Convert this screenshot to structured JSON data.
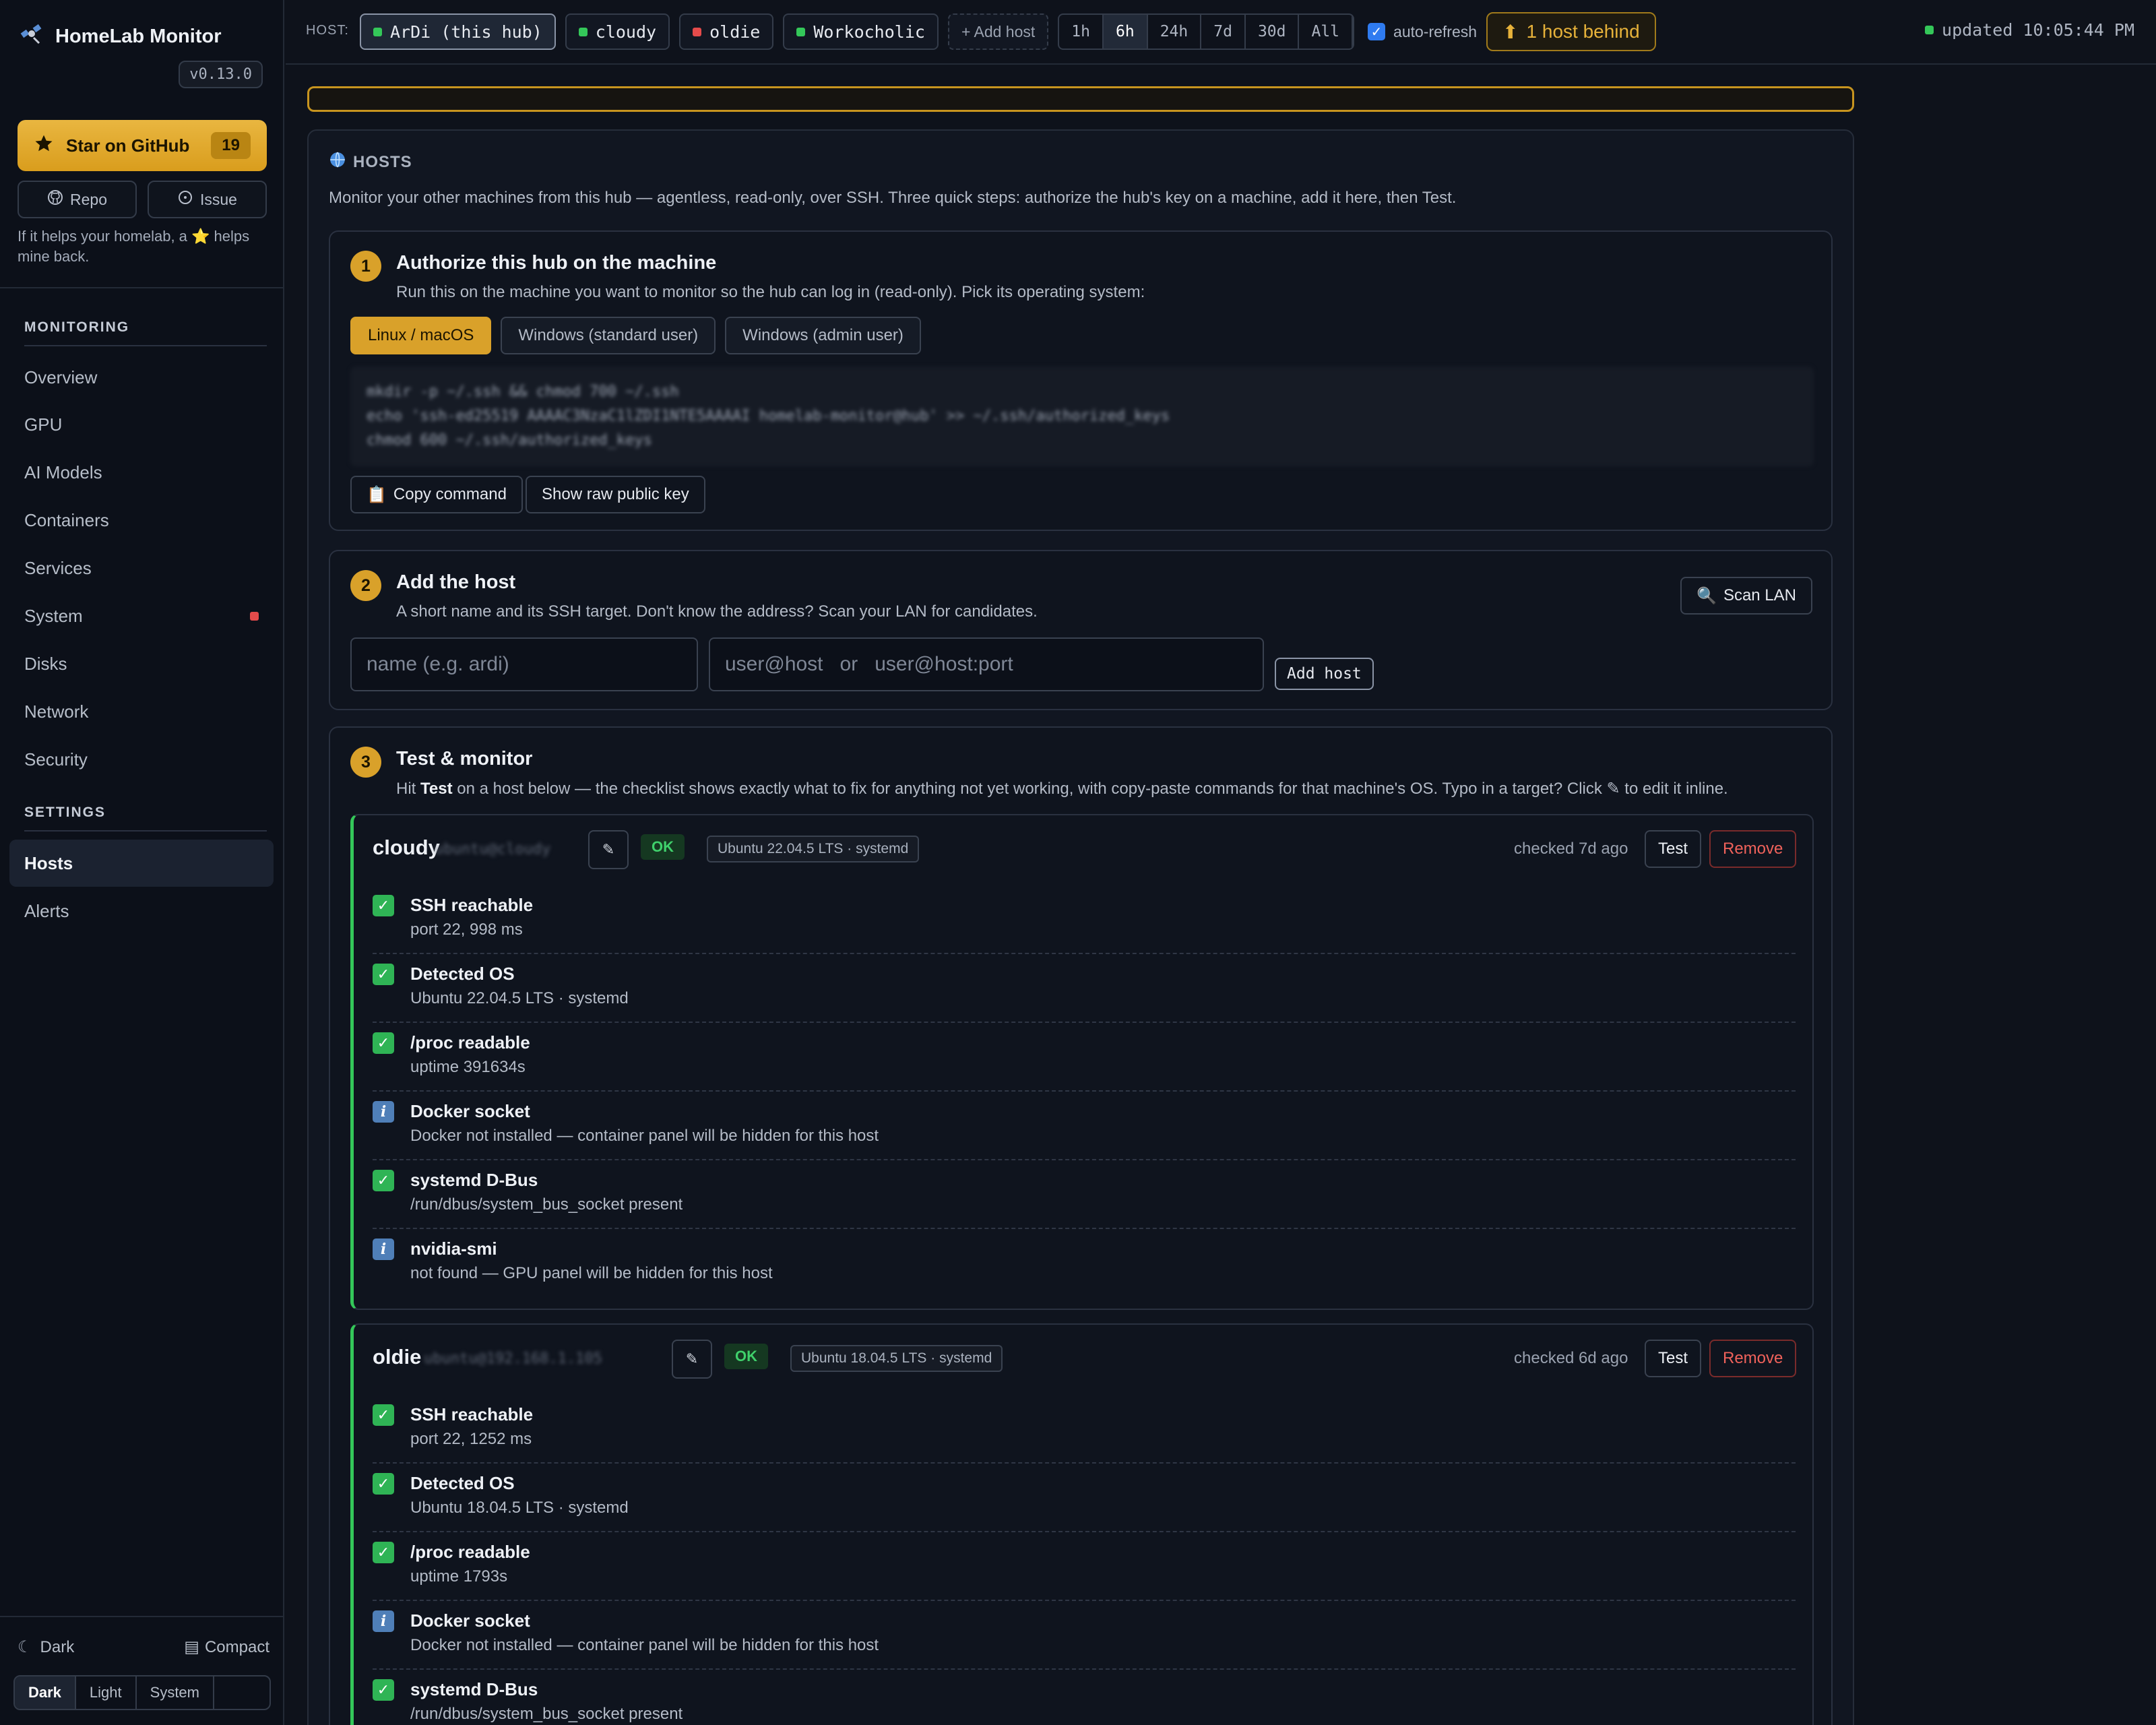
{
  "app": {
    "title": "HomeLab Monitor",
    "version": "v0.13.0"
  },
  "sidebar": {
    "star_label": "Star on GitHub",
    "star_count": "19",
    "repo_label": "Repo",
    "issue_label": "Issue",
    "tagline": "If it helps your homelab, a ⭐ helps mine back.",
    "monitoring_head": "MONITORING",
    "monitoring_items": [
      "Overview",
      "GPU",
      "AI Models",
      "Containers",
      "Services",
      "System",
      "Disks",
      "Network",
      "Security"
    ],
    "settings_head": "SETTINGS",
    "settings_items": [
      "Hosts",
      "Alerts"
    ],
    "theme_label": "Dark",
    "compact_label": "Compact",
    "theme_options": [
      "Dark",
      "Light",
      "System"
    ]
  },
  "topbar": {
    "host_label": "HOST:",
    "hosts": [
      {
        "name": "ArDi (this hub)",
        "status_color": "#34c759"
      },
      {
        "name": "cloudy",
        "status_color": "#34c759"
      },
      {
        "name": "oldie",
        "status_color": "#e54b4b"
      },
      {
        "name": "Workocholic",
        "status_color": "#34c759"
      }
    ],
    "add_host_label": "+ Add host",
    "ranges": [
      "1h",
      "6h",
      "24h",
      "7d",
      "30d",
      "All"
    ],
    "selected_range": "6h",
    "auto_refresh_label": "auto-refresh",
    "behind_label": "1 host behind",
    "updated_label": "updated 10:05:44 PM"
  },
  "hosts_panel": {
    "title": "HOSTS",
    "description": "Monitor your other machines from this hub — agentless, read-only, over SSH. Three quick steps: authorize the hub's key on a machine, add it here, then Test.",
    "step1": {
      "num": "1",
      "title": "Authorize this hub on the machine",
      "subtitle": "Run this on the machine you want to monitor so the hub can log in (read-only). Pick its operating system:",
      "os_tabs": [
        "Linux / macOS",
        "Windows (standard user)",
        "Windows (admin user)"
      ],
      "code_lines": [
        "mkdir -p ~/.ssh && chmod 700 ~/.ssh",
        "echo 'ssh-ed25519 AAAAC3NzaC1lZDI1NTE5AAAAI homelab-monitor@hub' >> ~/.ssh/authorized_keys",
        "chmod 600 ~/.ssh/authorized_keys"
      ],
      "copy_label": "Copy command",
      "raw_key_label": "Show raw public key"
    },
    "step2": {
      "num": "2",
      "title": "Add the host",
      "subtitle": "A short name and its SSH target. Don't know the address? Scan your LAN for candidates.",
      "scan_label": "Scan LAN",
      "name_placeholder": "name (e.g. ardi)",
      "target_placeholder": "user@host   or   user@host:port",
      "add_label": "Add host"
    },
    "step3": {
      "num": "3",
      "title": "Test & monitor",
      "subtitle_pre": "Hit ",
      "subtitle_bold": "Test",
      "subtitle_post": " on a host below — the checklist shows exactly what to fix for anything not yet working, with copy-paste commands for that machine's OS. Typo in a target? Click ✎ to edit it inline."
    },
    "host_cards": [
      {
        "name": "cloudy",
        "target": "ubuntu@cloudy",
        "status": "OK",
        "os": "Ubuntu 22.04.5 LTS · systemd",
        "checked": "checked 7d ago",
        "test_label": "Test",
        "remove_label": "Remove",
        "checks": [
          {
            "kind": "ok",
            "title": "SSH reachable",
            "detail": "port 22, 998 ms"
          },
          {
            "kind": "ok",
            "title": "Detected OS",
            "detail": "Ubuntu 22.04.5 LTS · systemd"
          },
          {
            "kind": "ok",
            "title": "/proc readable",
            "detail": "uptime 391634s"
          },
          {
            "kind": "info",
            "title": "Docker socket",
            "detail": "Docker not installed — container panel will be hidden for this host"
          },
          {
            "kind": "ok",
            "title": "systemd D-Bus",
            "detail": "/run/dbus/system_bus_socket present"
          },
          {
            "kind": "info",
            "title": "nvidia-smi",
            "detail": "not found — GPU panel will be hidden for this host"
          }
        ]
      },
      {
        "name": "oldie",
        "target": "ubuntu@192.168.1.105",
        "status": "OK",
        "os": "Ubuntu 18.04.5 LTS · systemd",
        "checked": "checked 6d ago",
        "test_label": "Test",
        "remove_label": "Remove",
        "checks": [
          {
            "kind": "ok",
            "title": "SSH reachable",
            "detail": "port 22, 1252 ms"
          },
          {
            "kind": "ok",
            "title": "Detected OS",
            "detail": "Ubuntu 18.04.5 LTS · systemd"
          },
          {
            "kind": "ok",
            "title": "/proc readable",
            "detail": "uptime 1793s"
          },
          {
            "kind": "info",
            "title": "Docker socket",
            "detail": "Docker not installed — container panel will be hidden for this host"
          },
          {
            "kind": "ok",
            "title": "systemd D-Bus",
            "detail": "/run/dbus/system_bus_socket present"
          }
        ]
      }
    ]
  }
}
